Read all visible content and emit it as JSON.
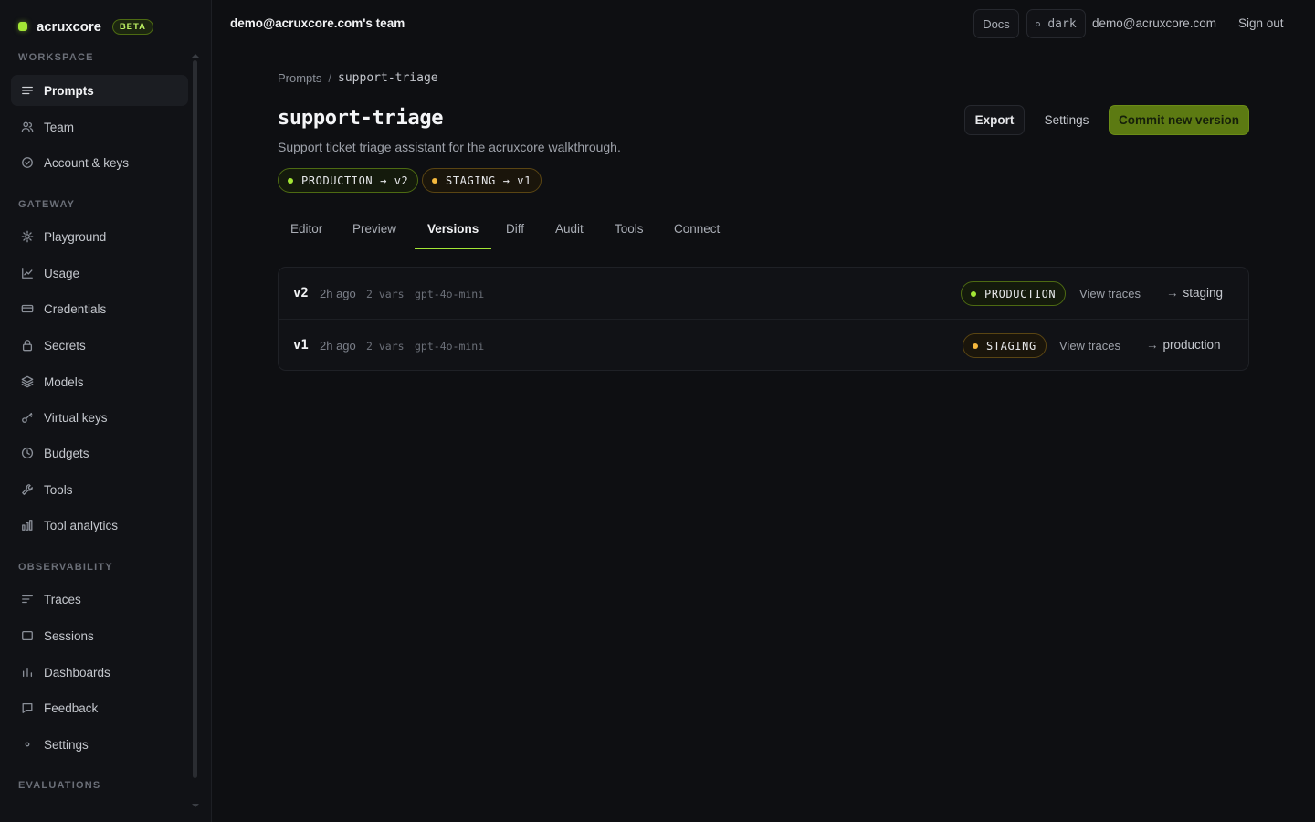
{
  "brand": {
    "name": "acruxcore",
    "badge": "BETA"
  },
  "sidebar": {
    "sections": {
      "workspace": "WORKSPACE",
      "gateway": "GATEWAY",
      "observability": "OBSERVABILITY",
      "evaluations": "EVALUATIONS"
    },
    "items": [
      {
        "label": "Prompts",
        "icon": "list-icon",
        "active": true
      },
      {
        "label": "Team",
        "icon": "users-icon"
      },
      {
        "label": "Account & keys",
        "icon": "check-circle-icon"
      },
      {
        "label": "Playground",
        "icon": "sun-icon"
      },
      {
        "label": "Usage",
        "icon": "line-chart-icon"
      },
      {
        "label": "Credentials",
        "icon": "card-icon"
      },
      {
        "label": "Secrets",
        "icon": "lock-icon"
      },
      {
        "label": "Models",
        "icon": "layers-icon"
      },
      {
        "label": "Virtual keys",
        "icon": "key-icon"
      },
      {
        "label": "Budgets",
        "icon": "clock-icon"
      },
      {
        "label": "Tools",
        "icon": "wrench-icon"
      },
      {
        "label": "Tool analytics",
        "icon": "bar-chart-icon"
      },
      {
        "label": "Traces",
        "icon": "traces-icon"
      },
      {
        "label": "Sessions",
        "icon": "window-icon"
      },
      {
        "label": "Dashboards",
        "icon": "bars-icon"
      },
      {
        "label": "Feedback",
        "icon": "message-icon"
      },
      {
        "label": "Settings",
        "icon": "dot-icon"
      }
    ]
  },
  "topbar": {
    "team": "demo@acruxcore.com's team",
    "docs": "Docs",
    "theme": "dark",
    "email": "demo@acruxcore.com",
    "signout": "Sign out"
  },
  "breadcrumb": {
    "root": "Prompts",
    "separator": "/",
    "current": "support-triage"
  },
  "prompt": {
    "title": "support-triage",
    "description": "Support ticket triage assistant for the acruxcore walkthrough.",
    "envs": [
      {
        "label": "PRODUCTION → v2",
        "status_color": "#a3e635"
      },
      {
        "label": "STAGING → v1",
        "status_color": "#f5b83d"
      }
    ]
  },
  "actions": {
    "export": "Export",
    "settings": "Settings",
    "commit": "Commit new version"
  },
  "tabs": [
    "Editor",
    "Preview",
    "Versions",
    "Diff",
    "Audit",
    "Tools",
    "Connect"
  ],
  "active_tab": "Versions",
  "versions": [
    {
      "name": "v2",
      "time": "2h ago",
      "vars": "2 vars",
      "model": "gpt-4o-mini",
      "env": "PRODUCTION",
      "view": "View traces",
      "promote": "staging"
    },
    {
      "name": "v1",
      "time": "2h ago",
      "vars": "2 vars",
      "model": "gpt-4o-mini",
      "env": "STAGING",
      "view": "View traces",
      "promote": "production"
    }
  ],
  "colors": {
    "accent": "#a3e635",
    "commit": "#5c7a12",
    "staging": "#f5b83d",
    "bg": "#0e0f12"
  }
}
